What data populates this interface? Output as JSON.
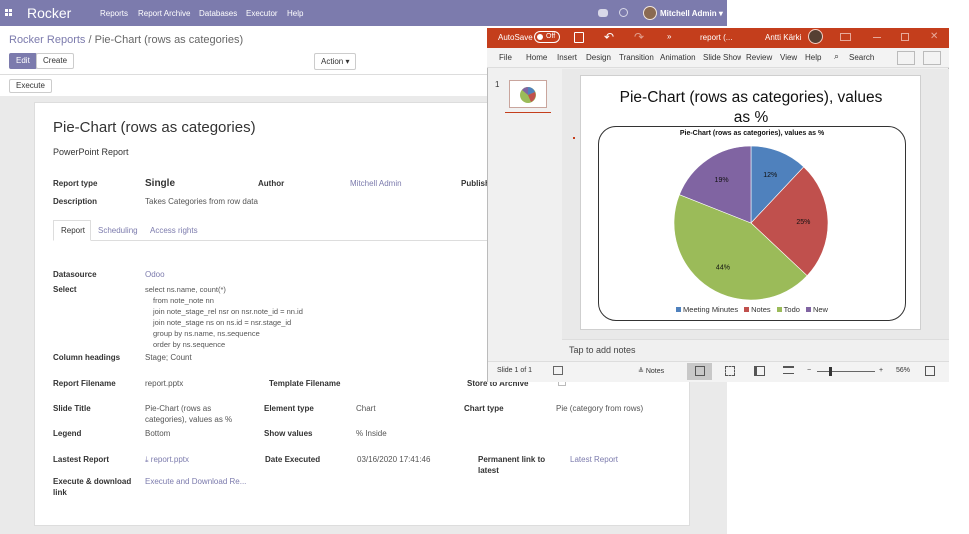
{
  "app": {
    "brand": "Rocker",
    "menu": [
      "Reports",
      "Report Archive",
      "Databases",
      "Executor",
      "Help"
    ],
    "user": "Mitchell Admin"
  },
  "breadcrumb": {
    "parent": "Rocker Reports",
    "separator": "/",
    "current": "Pie-Chart (rows as categories)"
  },
  "toolbar": {
    "edit": "Edit",
    "create": "Create",
    "action": "Action",
    "execute": "Execute"
  },
  "report": {
    "title": "Pie-Chart (rows as categories)",
    "subtitle": "PowerPoint Report",
    "fields": {
      "report_type_label": "Report type",
      "report_type_value": "Single",
      "author_label": "Author",
      "author_value": "Mitchell Admin",
      "publish_label": "Publish",
      "description_label": "Description",
      "description_value": "Takes Categories from row data"
    },
    "tabs": [
      "Report",
      "Scheduling",
      "Access rights"
    ],
    "details": {
      "datasource_label": "Datasource",
      "datasource_value": "Odoo",
      "select_label": "Select",
      "select_lines": [
        "select ns.name, count(*)",
        "from note_note nn",
        "join note_stage_rel nsr on nsr.note_id = nn.id",
        "join note_stage ns on ns.id = nsr.stage_id",
        "group by ns.name, ns.sequence",
        "order by ns.sequence"
      ],
      "column_headings_label": "Column headings",
      "column_headings_value": "Stage; Count",
      "report_filename_label": "Report Filename",
      "report_filename_value": "report.pptx",
      "template_filename_label": "Template Filename",
      "store_archive_label": "Store to Archive",
      "slide_title_label": "Slide Title",
      "slide_title_value_1": "Pie-Chart (rows as",
      "slide_title_value_2": "categories), values as %",
      "element_type_label": "Element type",
      "element_type_value": "Chart",
      "chart_type_label": "Chart type",
      "chart_type_value": "Pie (category from rows)",
      "legend_label": "Legend",
      "legend_value": "Bottom",
      "show_values_label": "Show values",
      "show_values_value": "% Inside",
      "latest_report_label": "Lastest Report",
      "latest_report_value": "report.pptx",
      "date_executed_label": "Date Executed",
      "date_executed_value": "03/16/2020 17:41:46",
      "permanent_link_label_1": "Permanent link to",
      "permanent_link_label_2": "latest",
      "permanent_link_value": "Latest Report",
      "execute_download_label_1": "Execute & download",
      "execute_download_label_2": "link",
      "execute_download_value": "Execute and Download Re..."
    }
  },
  "powerpoint": {
    "autosave": "AutoSave",
    "autosave_state": "Off",
    "doc_title": "report (...",
    "user": "Antti Kärki",
    "menu": [
      "File",
      "Home",
      "Insert",
      "Design",
      "Transition",
      "Animation",
      "Slide Show",
      "Review",
      "View",
      "Help"
    ],
    "search": "Search",
    "slide_number": "1",
    "slide_title_1": "Pie-Chart (rows as categories), values",
    "slide_title_2": "as %",
    "notes_placeholder": "Tap to add notes",
    "status_slide": "Slide 1 of 1",
    "status_notes": "Notes",
    "zoom": "56%",
    "accent": "#c43e1c"
  },
  "chart_data": {
    "type": "pie",
    "title": "Pie-Chart (rows as categories), values as %",
    "categories": [
      "Meeting Minutes",
      "Notes",
      "Todo",
      "New"
    ],
    "values": [
      12,
      25,
      44,
      19
    ],
    "labels": [
      "12%",
      "25%",
      "44%",
      "19%"
    ],
    "colors": [
      "#4f81bd",
      "#c0504d",
      "#9bbb59",
      "#8064a2"
    ],
    "legend": "bottom",
    "legend_entries": [
      "Meeting Minutes",
      "Notes",
      "Todo",
      "New"
    ]
  }
}
